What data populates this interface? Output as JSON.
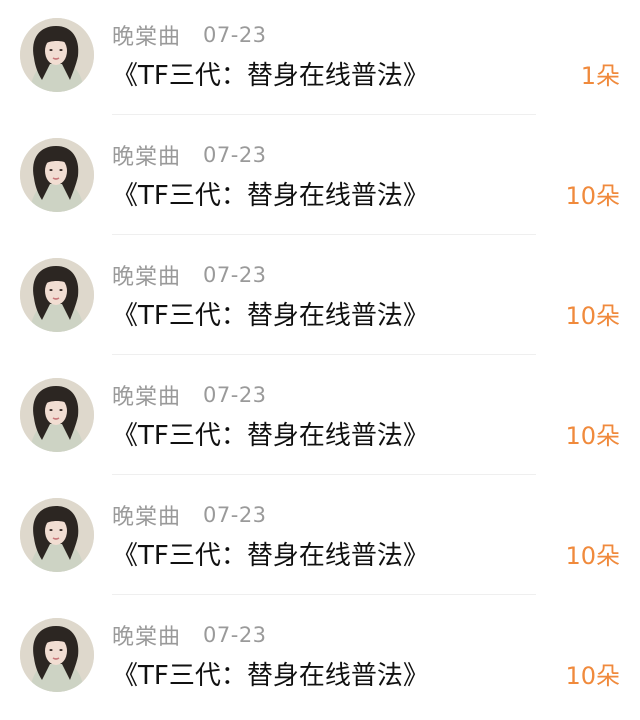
{
  "colors": {
    "meta_text": "#9a9a9a",
    "title_text": "#111111",
    "count_text": "#f08a3c",
    "divider": "#efefef"
  },
  "items": [
    {
      "user": "晚棠曲",
      "date": "07-23",
      "title": "《TF三代：替身在线普法》",
      "count": "1朵",
      "avatar_icon": "user-avatar-portrait"
    },
    {
      "user": "晚棠曲",
      "date": "07-23",
      "title": "《TF三代：替身在线普法》",
      "count": "10朵",
      "avatar_icon": "user-avatar-portrait"
    },
    {
      "user": "晚棠曲",
      "date": "07-23",
      "title": "《TF三代：替身在线普法》",
      "count": "10朵",
      "avatar_icon": "user-avatar-portrait"
    },
    {
      "user": "晚棠曲",
      "date": "07-23",
      "title": "《TF三代：替身在线普法》",
      "count": "10朵",
      "avatar_icon": "user-avatar-portrait"
    },
    {
      "user": "晚棠曲",
      "date": "07-23",
      "title": "《TF三代：替身在线普法》",
      "count": "10朵",
      "avatar_icon": "user-avatar-portrait"
    },
    {
      "user": "晚棠曲",
      "date": "07-23",
      "title": "《TF三代：替身在线普法》",
      "count": "10朵",
      "avatar_icon": "user-avatar-portrait"
    }
  ]
}
